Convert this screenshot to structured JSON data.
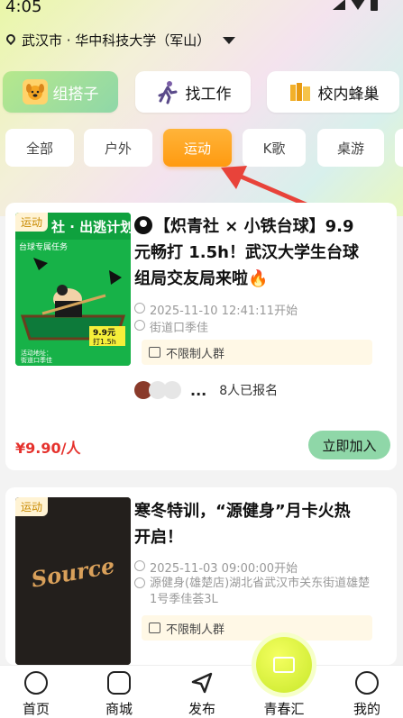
{
  "status": {
    "time": "4:05"
  },
  "location": {
    "text": "武汉市 · 华中科技大学（军山）"
  },
  "categories": [
    {
      "label": "组搭子",
      "icon": "dog-face-icon",
      "active": true
    },
    {
      "label": "找工作",
      "icon": "runner-icon",
      "active": false
    },
    {
      "label": "校内蜂巢",
      "icon": "books-icon",
      "active": false
    }
  ],
  "tabs": [
    "全部",
    "户外",
    "运动",
    "K歌",
    "桌游"
  ],
  "active_tab": "运动",
  "events": [
    {
      "badge": "运动",
      "title": "🎱【炽青社 × 小铁台球】9.9元畅打 1.5h！武汉大学生台球组局交友局来啦🔥",
      "title_lines": [
        "【炽青社 × 小铁台球】9.9",
        "元畅打 1.5h！武汉大学生台球",
        "组局交友局来啦🔥"
      ],
      "time": "2025-11-10 12:41:11开始",
      "place": "街道口季佳",
      "tag": "不限制人群",
      "signup": "8人已报名",
      "dots": "...",
      "price": "¥9.90/人",
      "button": "立即加入",
      "poster_text": {
        "header": "社 · 出逃计划",
        "sub": "台球专属任务",
        "price": "9.9元",
        "dur": "打1.5h",
        "foot1": "活动地址：",
        "foot2": "街道口季佳"
      }
    },
    {
      "badge": "运动",
      "title_lines": [
        "寒冬特训，“源健身”月卡火热",
        "开启！"
      ],
      "time": "2025-11-03 09:00:00开始",
      "place_lines": [
        "源健身(雄楚店)湖北省武汉市关东街道雄楚",
        "1号季佳荟3L"
      ],
      "tag": "不限制人群",
      "poster_text": {
        "logo": "Source"
      }
    }
  ],
  "nav": [
    {
      "label": "首页",
      "icon": "home-icon"
    },
    {
      "label": "商城",
      "icon": "shop-bag-icon"
    },
    {
      "label": "发布",
      "icon": "send-icon"
    },
    {
      "label": "青春汇",
      "icon": "id-card-icon"
    },
    {
      "label": "我的",
      "icon": "profile-icon"
    }
  ],
  "colors": {
    "accent_orange": "#ff9a10",
    "accent_green": "#8fd7a8",
    "price_red": "#e5322d"
  }
}
